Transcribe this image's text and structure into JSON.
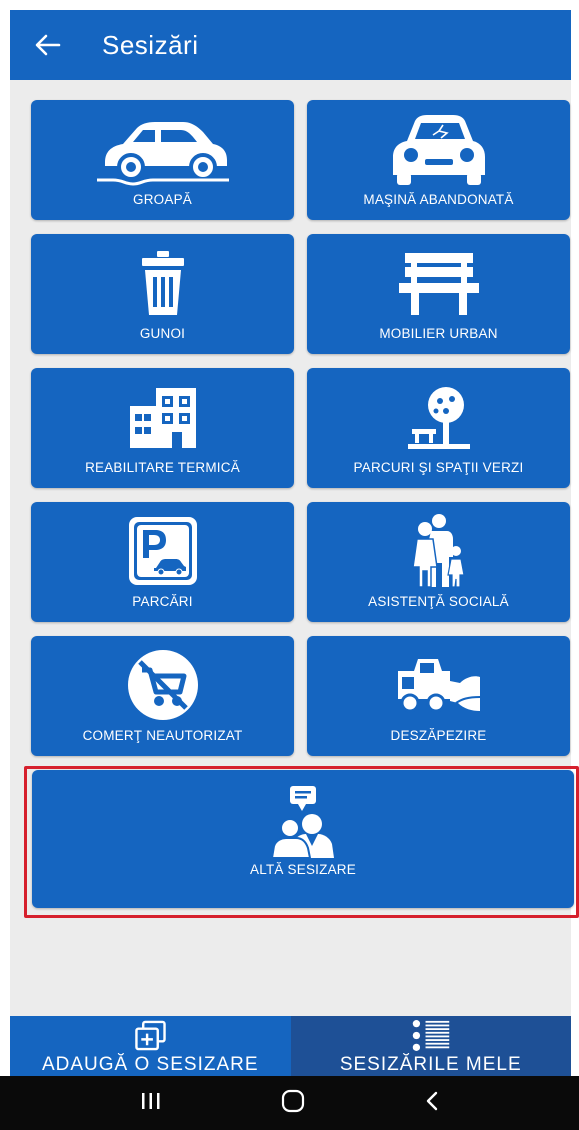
{
  "appbar": {
    "title": "Sesizări"
  },
  "tiles": {
    "groapa": "GROAPĂ",
    "masina_abandonata": "MAŞINĂ ABANDONATĂ",
    "gunoi": "GUNOI",
    "mobilier_urban": "MOBILIER URBAN",
    "reabilitare_termica": "REABILITARE TERMICĂ",
    "parcuri": "PARCURI ŞI SPAŢII VERZI",
    "parcari": "PARCĂRI",
    "asistenta_sociala": "ASISTENŢĂ SOCIALĂ",
    "comert_neautorizat": "COMERŢ NEAUTORIZAT",
    "deszapezire": "DESZĂPEZIRE",
    "alta_sesizare": "ALTĂ SESIZARE"
  },
  "bottom_nav": {
    "add_label": "ADAUGĂ O SESIZARE",
    "mine_label": "SESIZĂRILE MELE"
  },
  "icons": {
    "back": "arrow-left-icon",
    "groapa": "car-pothole-icon",
    "masina_abandonata": "wrecked-car-icon",
    "gunoi": "trash-can-icon",
    "mobilier_urban": "bench-icon",
    "reabilitare_termica": "building-icon",
    "parcuri": "tree-park-icon",
    "parcari": "parking-sign-icon",
    "asistenta_sociala": "family-icon",
    "comert_neautorizat": "no-cart-icon",
    "deszapezire": "snowplow-icon",
    "alta_sesizare": "people-chat-icon",
    "add": "add-layers-icon",
    "mine": "list-icon",
    "sys_recents": "recents-icon",
    "sys_home": "home-icon",
    "sys_back": "back-chevron-icon"
  },
  "colors": {
    "primary": "#1565c0",
    "nav_selected": "#1e5096",
    "background": "#ececec",
    "highlight": "#d6202d"
  }
}
